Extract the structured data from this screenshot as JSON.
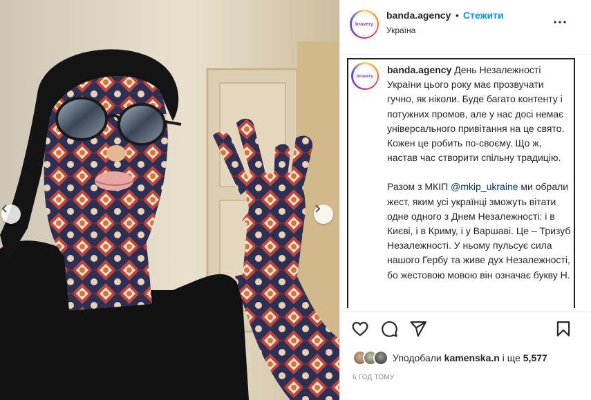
{
  "post": {
    "username": "banda.agency",
    "separator": "•",
    "follow_label": "Стежити",
    "location": "Україна",
    "avatar_text": "bravery",
    "more_icon": "more-horizontal-icon"
  },
  "caption": {
    "username": "banda.agency",
    "paragraph1": "День Незалежності України цього року має прозвучати гучно, як ніколи. Буде багато контенту і потужних промов, але у нас досі немає універсального привітання на це свято. Кожен це робить по-своєму. Що ж, настав час створити спільну традицію.",
    "paragraph2_before": "Разом з МКІП ",
    "mention": "@mkip_ukraine",
    "paragraph2_after": " ми обрали жест, яким усі українці зможуть вітати одне одного з Днем Незалежності: і в Києві, і в Криму, і у Варшаві. Це – Тризуб Незалежності. У ньому пульсує сила нашого Гербу та живе дух Незалежності, бо жестовою мовою він означає букву Н."
  },
  "actions": {
    "like_icon": "heart-icon",
    "comment_icon": "comment-icon",
    "share_icon": "send-icon",
    "save_icon": "bookmark-icon"
  },
  "likes": {
    "prefix": "Уподобали ",
    "user": "kamenska.n",
    "middle": " і ще ",
    "count": "5,577"
  },
  "timestamp": "6 ГОД ТОМУ",
  "colors": {
    "accent": "#0095f6",
    "mention": "#00376b",
    "text": "#262626",
    "muted": "#8e8e8e"
  }
}
